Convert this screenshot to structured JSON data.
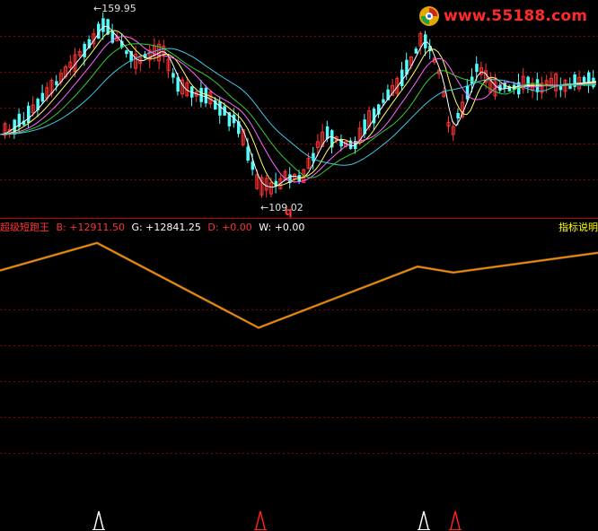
{
  "chart": {
    "high_label": "159.95",
    "low_label": "109.02",
    "low_marker": "q"
  },
  "indicator": {
    "name": "超级短跑王",
    "b": "B: +12911.50",
    "g": "G: +12841.25",
    "d": "D: +0.00",
    "w": "W: +0.00",
    "help": "指标说明"
  },
  "logo": {
    "text": "www.55188.com"
  },
  "colors": {
    "bg": "#000000",
    "up": "#ff3232",
    "down": "#54fcfc",
    "grid": "#8b0000",
    "divider": "#c00000",
    "ind_line": "#ff8c00"
  },
  "chart_data": {
    "type": "line",
    "series": [
      {
        "name": "B",
        "values": [
          0.82,
          0.96,
          0.53,
          0.84,
          0.81,
          0.91
        ]
      }
    ],
    "signals": [
      "white",
      "red",
      "white",
      "red"
    ]
  }
}
